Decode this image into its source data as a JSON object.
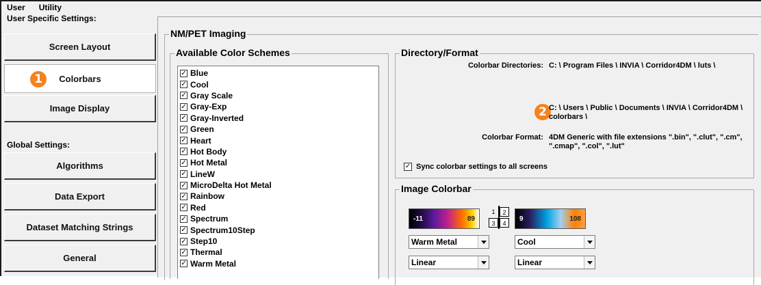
{
  "menu": [
    "User",
    "Utility"
  ],
  "nav": {
    "user_section_label": "User Specific Settings:",
    "global_section_label": "Global Settings:",
    "user_items": [
      {
        "label": "Screen Layout"
      },
      {
        "label": "Colorbars",
        "active": true
      },
      {
        "label": "Image Display"
      }
    ],
    "global_items": [
      {
        "label": "Algorithms"
      },
      {
        "label": "Data Export"
      },
      {
        "label": "Dataset Matching Strings"
      },
      {
        "label": "General"
      }
    ]
  },
  "callouts": {
    "one": "1",
    "two": "2"
  },
  "main": {
    "title": "NM/PET Imaging",
    "schemes": {
      "title": "Available Color Schemes",
      "items": [
        "Blue",
        "Cool",
        "Gray Scale",
        "Gray-Exp",
        "Gray-Inverted",
        "Green",
        "Heart",
        "Hot Body",
        "Hot Metal",
        "LineW",
        "MicroDelta Hot Metal",
        "Rainbow",
        "Red",
        "Spectrum",
        "Spectrum10Step",
        "Step10",
        "Thermal",
        "Warm Metal"
      ],
      "check_glyph": "✓"
    },
    "directory": {
      "title": "Directory/Format",
      "dirs_label": "Colorbar Directories:",
      "dir1": "C: \\ Program Files \\ INVIA \\ Corridor4DM \\ luts \\",
      "dir2_line1": "C: \\ Users \\ Public \\ Documents \\ INVIA \\ Corridor4DM \\",
      "dir2_line2": "colorbars \\",
      "format_label": "Colorbar Format:",
      "format_line1": "4DM Generic with file extensions \".bin\", \".clut\", \".cm\",",
      "format_line2": "\".cmap\", \".col\", \".lut\"",
      "sync_label": "Sync colorbar settings to all screens",
      "sync_checked": true
    },
    "image_colorbar": {
      "title": "Image Colorbar",
      "left_bar": {
        "min": "-11",
        "max": "89"
      },
      "right_bar": {
        "min": "9",
        "max": "108"
      },
      "layout_cells": [
        "1",
        "2",
        "3",
        "4"
      ],
      "left_scheme": "Warm Metal",
      "right_scheme": "Cool",
      "left_scale": "Linear",
      "right_scale": "Linear"
    }
  },
  "colors": {
    "callout": "#f58220",
    "panel": "#f0f0f0"
  }
}
